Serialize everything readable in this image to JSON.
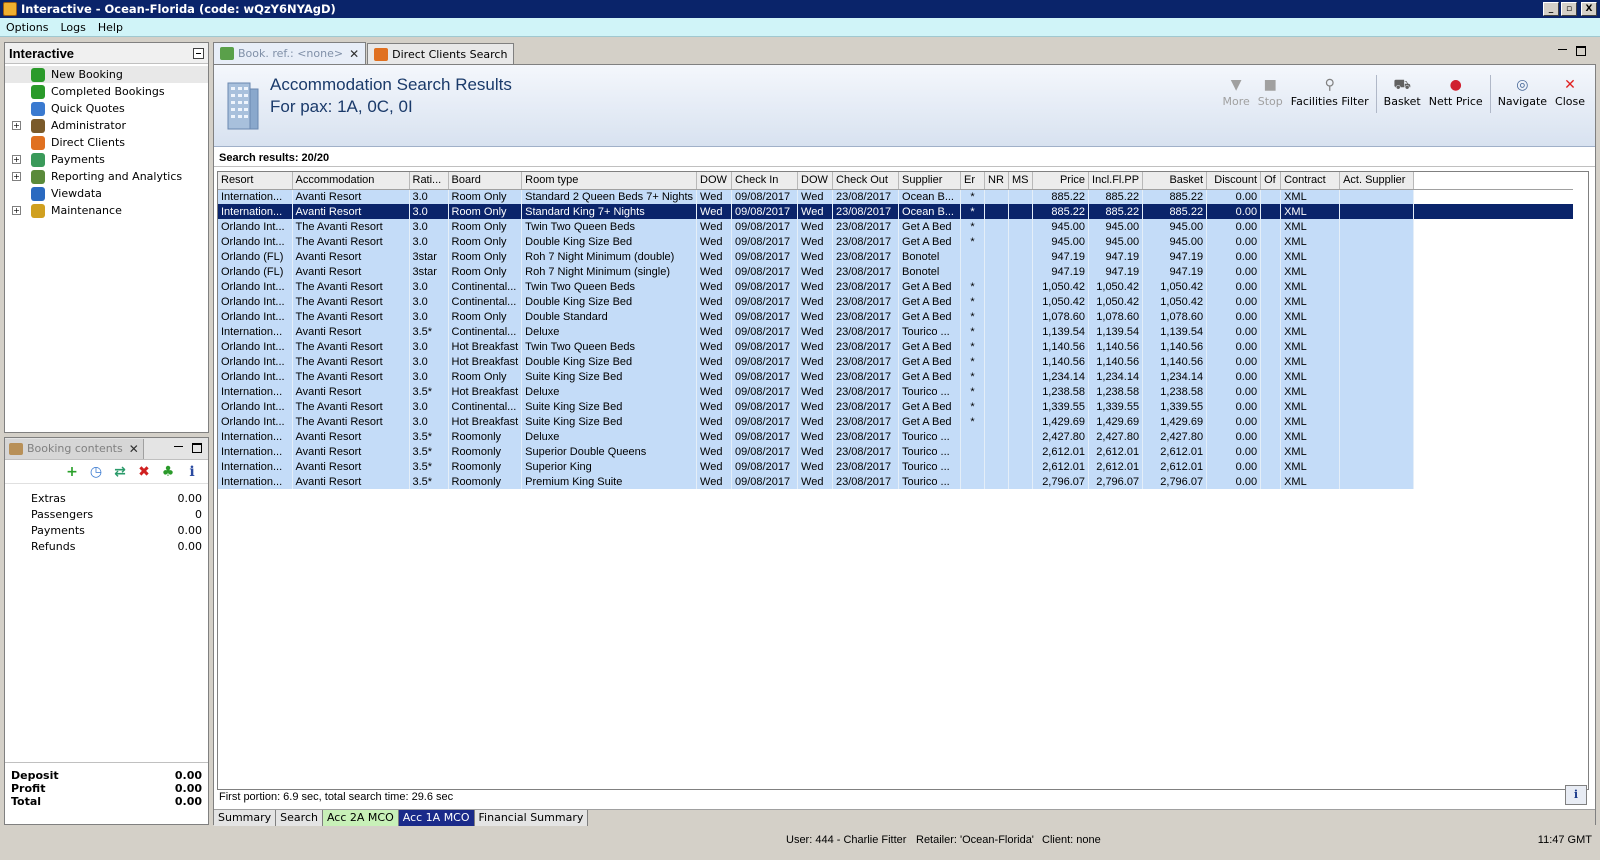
{
  "window": {
    "title": "Interactive - Ocean-Florida (code: wQzY6NYAgD)",
    "controls": [
      "_",
      "▫",
      "X"
    ]
  },
  "menu": [
    "Options",
    "Logs",
    "Help"
  ],
  "nav": {
    "title": "Interactive",
    "items": [
      {
        "label": "New Booking",
        "icon": "palm-tree-icon",
        "color": "#2a9a2a",
        "expandable": false
      },
      {
        "label": "Completed Bookings",
        "icon": "palm-tree-icon",
        "color": "#2a9a2a",
        "expandable": false
      },
      {
        "label": "Quick Quotes",
        "icon": "clock-icon",
        "color": "#3a7ad0",
        "expandable": false
      },
      {
        "label": "Administrator",
        "icon": "person-icon",
        "color": "#7a5a2a",
        "expandable": true
      },
      {
        "label": "Direct Clients",
        "icon": "umbrella-icon",
        "color": "#e07020",
        "expandable": false
      },
      {
        "label": "Payments",
        "icon": "money-icon",
        "color": "#3a9a5a",
        "expandable": true
      },
      {
        "label": "Reporting and Analytics",
        "icon": "report-icon",
        "color": "#5a8a3a",
        "expandable": true
      },
      {
        "label": "Viewdata",
        "icon": "globe-icon",
        "color": "#2a6ac0",
        "expandable": false
      },
      {
        "label": "Maintenance",
        "icon": "book-icon",
        "color": "#d0a020",
        "expandable": true
      }
    ]
  },
  "booking_contents": {
    "tab_label": "Booking contents",
    "toolbar": [
      "add-icon",
      "clock-icon",
      "swap-icon",
      "delete-icon",
      "palm-tree-icon",
      "info-icon"
    ],
    "rows": [
      {
        "label": "Extras",
        "value": "0.00"
      },
      {
        "label": "Passengers",
        "value": "0"
      },
      {
        "label": "Payments",
        "value": "0.00"
      },
      {
        "label": "Refunds",
        "value": "0.00"
      }
    ],
    "summary": [
      {
        "label": "Deposit",
        "value": "0.00"
      },
      {
        "label": "Profit",
        "value": "0.00"
      },
      {
        "label": "Total",
        "value": "0.00"
      }
    ]
  },
  "tabs": [
    {
      "label": "Book. ref.: <none>",
      "active": true,
      "closable": true
    },
    {
      "label": "Direct Clients Search",
      "active": false,
      "closable": false
    }
  ],
  "search": {
    "title": "Accommodation Search Results",
    "subtitle": "For pax: 1A, 0C, 0I",
    "actions": [
      {
        "label": "More",
        "icon": "down-arrow-icon",
        "enabled": false
      },
      {
        "label": "Stop",
        "icon": "stop-icon",
        "enabled": false
      },
      {
        "label": "Facilities Filter",
        "icon": "filter-icon",
        "enabled": true
      },
      {
        "label": "Basket",
        "icon": "basket-icon",
        "enabled": true
      },
      {
        "label": "Nett Price",
        "icon": "cherries-icon",
        "enabled": true
      },
      {
        "label": "Navigate",
        "icon": "compass-icon",
        "enabled": true
      },
      {
        "label": "Close",
        "icon": "close-icon",
        "enabled": true
      }
    ],
    "results_label": "Search results: 20/20",
    "columns": [
      "Resort",
      "Accommodation",
      "Rati...",
      "Board",
      "Room type",
      "DOW",
      "Check In",
      "DOW",
      "Check Out",
      "Supplier",
      "Er",
      "NR",
      "MS",
      "Price",
      "Incl.Fl.PP",
      "Basket",
      "Discount",
      "Of",
      "Contract",
      "Act. Supplier"
    ],
    "selected_row": 1,
    "rows": [
      [
        "Internation...",
        "Avanti Resort",
        "3.0",
        "Room Only",
        "Standard 2 Queen Beds 7+  Nights",
        "Wed",
        "09/08/2017",
        "Wed",
        "23/08/2017",
        "Ocean B...",
        "*",
        "",
        "",
        "885.22",
        "885.22",
        "885.22",
        "0.00",
        "",
        "XML",
        ""
      ],
      [
        "Internation...",
        "Avanti Resort",
        "3.0",
        "Room Only",
        "Standard King 7+ Nights",
        "Wed",
        "09/08/2017",
        "Wed",
        "23/08/2017",
        "Ocean B...",
        "*",
        "",
        "",
        "885.22",
        "885.22",
        "885.22",
        "0.00",
        "",
        "XML",
        ""
      ],
      [
        "Orlando Int...",
        "The Avanti Resort",
        "3.0",
        "Room Only",
        "Twin Two Queen Beds",
        "Wed",
        "09/08/2017",
        "Wed",
        "23/08/2017",
        "Get A Bed",
        "*",
        "",
        "",
        "945.00",
        "945.00",
        "945.00",
        "0.00",
        "",
        "XML",
        ""
      ],
      [
        "Orlando Int...",
        "The Avanti Resort",
        "3.0",
        "Room Only",
        "Double King Size Bed",
        "Wed",
        "09/08/2017",
        "Wed",
        "23/08/2017",
        "Get A Bed",
        "*",
        "",
        "",
        "945.00",
        "945.00",
        "945.00",
        "0.00",
        "",
        "XML",
        ""
      ],
      [
        "Orlando (FL)",
        "Avanti Resort",
        "3star",
        "Room Only",
        "Roh 7 Night Minimum  (double)",
        "Wed",
        "09/08/2017",
        "Wed",
        "23/08/2017",
        "Bonotel",
        "",
        "",
        "",
        "947.19",
        "947.19",
        "947.19",
        "0.00",
        "",
        "XML",
        ""
      ],
      [
        "Orlando (FL)",
        "Avanti Resort",
        "3star",
        "Room Only",
        "Roh 7 Night Minimum  (single)",
        "Wed",
        "09/08/2017",
        "Wed",
        "23/08/2017",
        "Bonotel",
        "",
        "",
        "",
        "947.19",
        "947.19",
        "947.19",
        "0.00",
        "",
        "XML",
        ""
      ],
      [
        "Orlando Int...",
        "The Avanti Resort",
        "3.0",
        "Continental...",
        "Twin Two Queen Beds",
        "Wed",
        "09/08/2017",
        "Wed",
        "23/08/2017",
        "Get A Bed",
        "*",
        "",
        "",
        "1,050.42",
        "1,050.42",
        "1,050.42",
        "0.00",
        "",
        "XML",
        ""
      ],
      [
        "Orlando Int...",
        "The Avanti Resort",
        "3.0",
        "Continental...",
        "Double King Size Bed",
        "Wed",
        "09/08/2017",
        "Wed",
        "23/08/2017",
        "Get A Bed",
        "*",
        "",
        "",
        "1,050.42",
        "1,050.42",
        "1,050.42",
        "0.00",
        "",
        "XML",
        ""
      ],
      [
        "Orlando Int...",
        "The Avanti Resort",
        "3.0",
        "Room Only",
        "Double Standard",
        "Wed",
        "09/08/2017",
        "Wed",
        "23/08/2017",
        "Get A Bed",
        "*",
        "",
        "",
        "1,078.60",
        "1,078.60",
        "1,078.60",
        "0.00",
        "",
        "XML",
        ""
      ],
      [
        "Internation...",
        "Avanti Resort",
        "3.5*",
        "Continental...",
        "Deluxe",
        "Wed",
        "09/08/2017",
        "Wed",
        "23/08/2017",
        "Tourico ...",
        "*",
        "",
        "",
        "1,139.54",
        "1,139.54",
        "1,139.54",
        "0.00",
        "",
        "XML",
        ""
      ],
      [
        "Orlando Int...",
        "The Avanti Resort",
        "3.0",
        "Hot Breakfast",
        "Twin Two Queen Beds",
        "Wed",
        "09/08/2017",
        "Wed",
        "23/08/2017",
        "Get A Bed",
        "*",
        "",
        "",
        "1,140.56",
        "1,140.56",
        "1,140.56",
        "0.00",
        "",
        "XML",
        ""
      ],
      [
        "Orlando Int...",
        "The Avanti Resort",
        "3.0",
        "Hot Breakfast",
        "Double King Size Bed",
        "Wed",
        "09/08/2017",
        "Wed",
        "23/08/2017",
        "Get A Bed",
        "*",
        "",
        "",
        "1,140.56",
        "1,140.56",
        "1,140.56",
        "0.00",
        "",
        "XML",
        ""
      ],
      [
        "Orlando Int...",
        "The Avanti Resort",
        "3.0",
        "Room Only",
        "Suite King Size Bed",
        "Wed",
        "09/08/2017",
        "Wed",
        "23/08/2017",
        "Get A Bed",
        "*",
        "",
        "",
        "1,234.14",
        "1,234.14",
        "1,234.14",
        "0.00",
        "",
        "XML",
        ""
      ],
      [
        "Internation...",
        "Avanti Resort",
        "3.5*",
        "Hot Breakfast",
        "Deluxe",
        "Wed",
        "09/08/2017",
        "Wed",
        "23/08/2017",
        "Tourico ...",
        "*",
        "",
        "",
        "1,238.58",
        "1,238.58",
        "1,238.58",
        "0.00",
        "",
        "XML",
        ""
      ],
      [
        "Orlando Int...",
        "The Avanti Resort",
        "3.0",
        "Continental...",
        "Suite King Size Bed",
        "Wed",
        "09/08/2017",
        "Wed",
        "23/08/2017",
        "Get A Bed",
        "*",
        "",
        "",
        "1,339.55",
        "1,339.55",
        "1,339.55",
        "0.00",
        "",
        "XML",
        ""
      ],
      [
        "Orlando Int...",
        "The Avanti Resort",
        "3.0",
        "Hot Breakfast",
        "Suite King Size Bed",
        "Wed",
        "09/08/2017",
        "Wed",
        "23/08/2017",
        "Get A Bed",
        "*",
        "",
        "",
        "1,429.69",
        "1,429.69",
        "1,429.69",
        "0.00",
        "",
        "XML",
        ""
      ],
      [
        "Internation...",
        "Avanti Resort",
        "3.5*",
        "Roomonly",
        "Deluxe",
        "Wed",
        "09/08/2017",
        "Wed",
        "23/08/2017",
        "Tourico ...",
        "",
        "",
        "",
        "2,427.80",
        "2,427.80",
        "2,427.80",
        "0.00",
        "",
        "XML",
        ""
      ],
      [
        "Internation...",
        "Avanti Resort",
        "3.5*",
        "Roomonly",
        "Superior Double Queens",
        "Wed",
        "09/08/2017",
        "Wed",
        "23/08/2017",
        "Tourico ...",
        "",
        "",
        "",
        "2,612.01",
        "2,612.01",
        "2,612.01",
        "0.00",
        "",
        "XML",
        ""
      ],
      [
        "Internation...",
        "Avanti Resort",
        "3.5*",
        "Roomonly",
        "Superior King",
        "Wed",
        "09/08/2017",
        "Wed",
        "23/08/2017",
        "Tourico ...",
        "",
        "",
        "",
        "2,612.01",
        "2,612.01",
        "2,612.01",
        "0.00",
        "",
        "XML",
        ""
      ],
      [
        "Internation...",
        "Avanti Resort",
        "3.5*",
        "Roomonly",
        "Premium King Suite",
        "Wed",
        "09/08/2017",
        "Wed",
        "23/08/2017",
        "Tourico ...",
        "",
        "",
        "",
        "2,796.07",
        "2,796.07",
        "2,796.07",
        "0.00",
        "",
        "XML",
        ""
      ]
    ],
    "timing": "First portion: 6.9 sec, total search time: 29.6 sec"
  },
  "bottom_tabs": [
    {
      "label": "Summary",
      "style": "normal"
    },
    {
      "label": "Search",
      "style": "normal"
    },
    {
      "label": "Acc 2A MCO",
      "style": "green"
    },
    {
      "label": "Acc 1A MCO",
      "style": "active"
    },
    {
      "label": "Financial Summary",
      "style": "normal"
    }
  ],
  "status": {
    "user": "User: 444 - Charlie Fitter",
    "retailer": "Retailer: 'Ocean-Florida'",
    "client": "Client: none",
    "time": "11:47 GMT"
  },
  "colors": {
    "titlebar": "#0a246a",
    "menubar": "#d0f4f8",
    "grid_row": "#c4dcf8",
    "selected_row": "#0a246a"
  }
}
